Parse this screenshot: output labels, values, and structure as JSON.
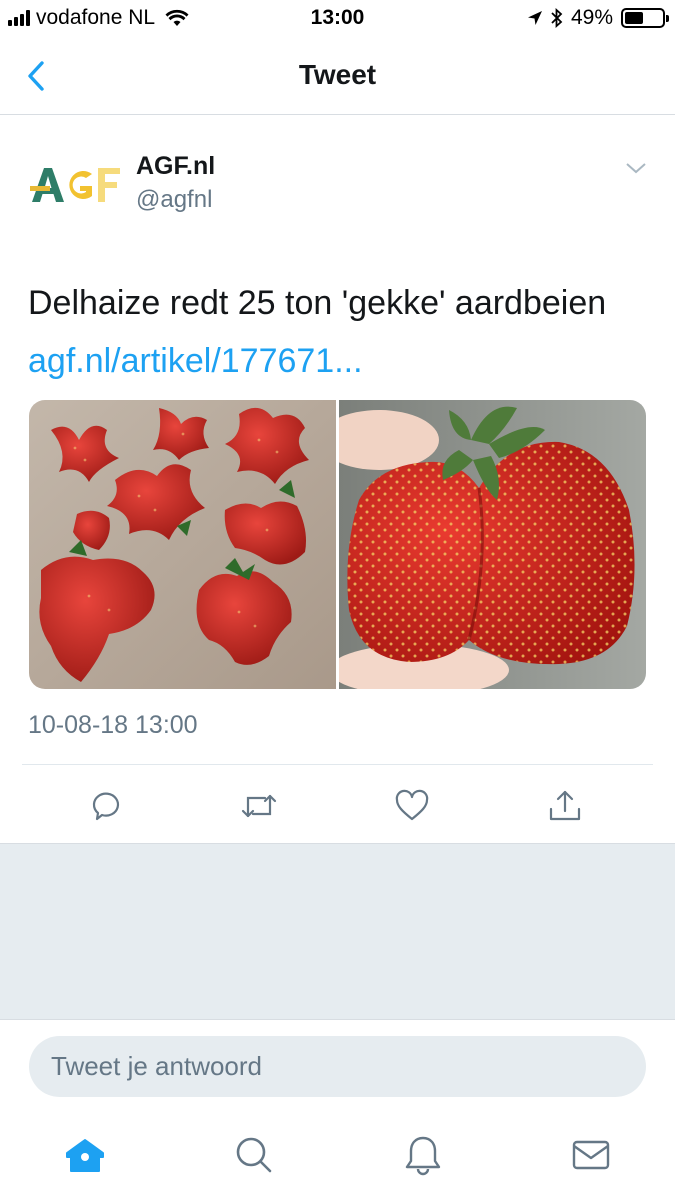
{
  "status_bar": {
    "carrier": "vodafone NL",
    "time": "13:00",
    "battery_percent": "49%",
    "battery_level": 0.49,
    "icons": [
      "signal-icon",
      "wifi-icon",
      "location-arrow-icon",
      "bluetooth-icon",
      "battery-icon"
    ]
  },
  "nav": {
    "title": "Tweet",
    "back_icon": "chevron-left-icon"
  },
  "tweet": {
    "author_name": "AGF.nl",
    "author_handle": "@agfnl",
    "text": "Delhaize redt 25 ton 'gekke' aardbeien",
    "link": "agf.nl/artikel/177671...",
    "timestamp": "10-08-18 13:00",
    "media": [
      "strawberry-photo-group",
      "strawberry-photo-closeup"
    ]
  },
  "actions": [
    "reply-icon",
    "retweet-icon",
    "like-icon",
    "share-icon"
  ],
  "reply": {
    "placeholder": "Tweet je antwoord"
  },
  "tabbar": {
    "items": [
      "home-icon",
      "search-icon",
      "notifications-icon",
      "messages-icon"
    ],
    "active": "home-icon"
  },
  "colors": {
    "accent": "#1da1f2",
    "text_primary": "#14171a",
    "text_secondary": "#657786",
    "background_gray": "#e6ecf0"
  }
}
